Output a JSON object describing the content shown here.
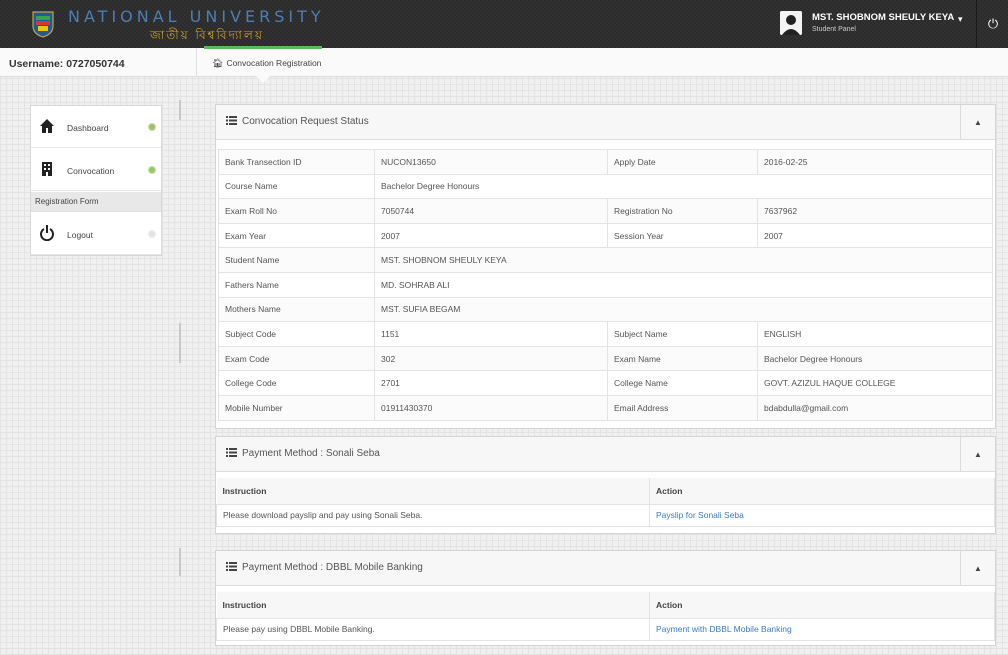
{
  "header": {
    "brand_en": "NATIONAL UNIVERSITY",
    "brand_bn": "জাতীয় বিশ্ববিদ্যালয়",
    "user_name": "MST. SHOBNOM SHEULY KEYA",
    "user_role": "Student Panel",
    "caret_icon": "caret-down-icon",
    "power_icon": "power-icon"
  },
  "subbar": {
    "username": "Username: 0727050744",
    "breadcrumb": "Convocation Registration"
  },
  "sidebar": {
    "items": [
      {
        "label": "Dashboard",
        "icon": "home-icon"
      },
      {
        "label": "Convocation",
        "icon": "building-icon"
      },
      {
        "label": "Registration Form"
      },
      {
        "label": "Logout",
        "icon": "power-icon"
      }
    ]
  },
  "status_panel": {
    "title": "Convocation Request Status",
    "rows": [
      {
        "l1": "Bank Transection ID",
        "v1": "NUCON13650",
        "l2": "Apply Date",
        "v2": "2016-02-25"
      },
      {
        "l1": "Course Name",
        "v1": "Bachelor Degree Honours"
      },
      {
        "l1": "Exam Roll No",
        "v1": "7050744",
        "l2": "Registration No",
        "v2": "7637962"
      },
      {
        "l1": "Exam Year",
        "v1": "2007",
        "l2": "Session Year",
        "v2": "2007"
      },
      {
        "l1": "Student Name",
        "v1": "MST. SHOBNOM SHEULY KEYA"
      },
      {
        "l1": "Fathers Name",
        "v1": "MD. SOHRAB ALI"
      },
      {
        "l1": "Mothers Name",
        "v1": "MST. SUFIA BEGAM"
      },
      {
        "l1": "Subject Code",
        "v1": "1151",
        "l2": "Subject Name",
        "v2": "ENGLISH"
      },
      {
        "l1": "Exam Code",
        "v1": "302",
        "l2": "Exam Name",
        "v2": "Bachelor Degree Honours"
      },
      {
        "l1": "College Code",
        "v1": "2701",
        "l2": "College Name",
        "v2": "GOVT. AZIZUL HAQUE COLLEGE"
      },
      {
        "l1": "Mobile Number",
        "v1": "01911430370",
        "l2": "Email Address",
        "v2": "bdabdulla@gmail.com"
      }
    ]
  },
  "payment_sonali": {
    "title": "Payment Method : Sonali Seba",
    "col_instruction": "Instruction",
    "col_action": "Action",
    "instruction": "Please download payslip and pay using Sonali Seba.",
    "action": "Payslip for Sonali Seba"
  },
  "payment_dbbl": {
    "title": "Payment Method : DBBL Mobile Banking",
    "col_instruction": "Instruction",
    "col_action": "Action",
    "instruction": "Please pay using DBBL Mobile Banking.",
    "action": "Payment with DBBL Mobile Banking"
  },
  "colors": {
    "topbar": "#2b2b2b",
    "brand_blue": "#4a7fb5",
    "brand_gold": "#d0a030",
    "active_green": "#5cb85c",
    "link_blue": "#3a7bc8"
  }
}
